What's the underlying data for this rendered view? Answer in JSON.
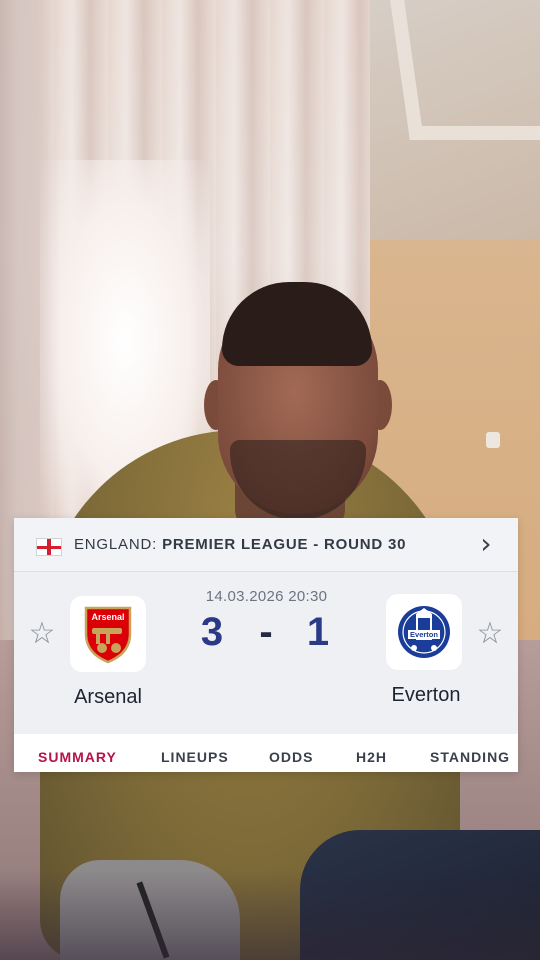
{
  "match_card": {
    "country": "ENGLAND:",
    "competition": "PREMIER LEAGUE - ROUND 30",
    "datetime": "14.03.2026 20:30",
    "home": {
      "name": "Arsenal",
      "score": "3",
      "crest_text": "Arsenal"
    },
    "separator": "-",
    "away": {
      "name": "Everton",
      "score": "1",
      "crest_text": "Everton"
    },
    "tabs": [
      {
        "label": "SUMMARY",
        "active": true
      },
      {
        "label": "LINEUPS",
        "active": false
      },
      {
        "label": "ODDS",
        "active": false
      },
      {
        "label": "H2H",
        "active": false
      },
      {
        "label": "STANDING",
        "active": false
      }
    ]
  },
  "colors": {
    "score": "#2b3a86",
    "active_tab": "#b3134a",
    "arsenal_red": "#db0007",
    "everton_blue": "#1b3d9a"
  },
  "icons": {
    "flag": "england-flag-icon",
    "chevron": "chevron-right-icon",
    "favorite": "star-outline-icon"
  }
}
